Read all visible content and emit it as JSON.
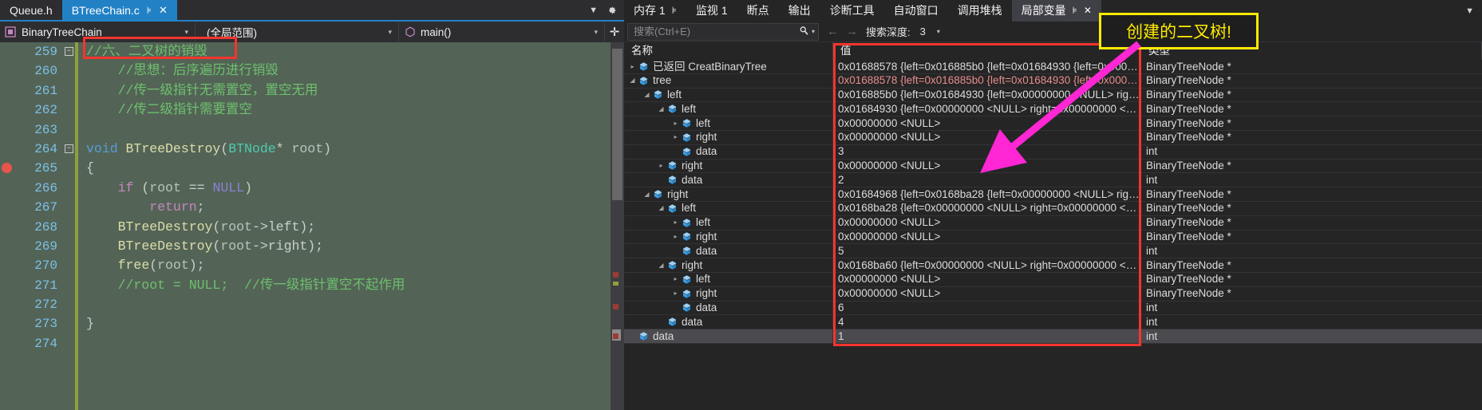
{
  "editor": {
    "tabs": [
      {
        "label": "Queue.h",
        "active": false
      },
      {
        "label": "BTreeChain.c",
        "active": true,
        "pin": "⊧",
        "close": "✕"
      }
    ],
    "nav": {
      "project": "BinaryTreeChain",
      "scope": "(全局范围)",
      "func": "main()",
      "arrow": "▾",
      "split_icon": "✛"
    },
    "lines": [
      {
        "num": "259",
        "fold": "−",
        "tokens": [
          {
            "t": "//六、二叉树的销毁",
            "c": "tok-comment"
          }
        ]
      },
      {
        "num": "260",
        "tokens": [
          {
            "t": "    //思想：后序遍历进行销毁",
            "c": "tok-comment"
          }
        ]
      },
      {
        "num": "261",
        "tokens": [
          {
            "t": "    //传一级指针无需置空，置空无用",
            "c": "tok-comment"
          }
        ]
      },
      {
        "num": "262",
        "tokens": [
          {
            "t": "    //传二级指针需要置空",
            "c": "tok-comment"
          }
        ]
      },
      {
        "num": "263",
        "tokens": []
      },
      {
        "num": "264",
        "fold": "−",
        "tokens": [
          {
            "t": "void",
            "c": "tok-kw"
          },
          {
            "t": " ",
            "c": "tok-plain"
          },
          {
            "t": "BTreeDestroy",
            "c": "tok-fn"
          },
          {
            "t": "(",
            "c": "tok-punct"
          },
          {
            "t": "BTNode",
            "c": "tok-type"
          },
          {
            "t": "* ",
            "c": "tok-punct"
          },
          {
            "t": "root",
            "c": "tok-plain"
          },
          {
            "t": ")",
            "c": "tok-punct"
          }
        ]
      },
      {
        "num": "265",
        "tokens": [
          {
            "t": "{",
            "c": "tok-punct"
          }
        ],
        "breakpoint": true
      },
      {
        "num": "266",
        "tokens": [
          {
            "t": "    ",
            "c": "tok-plain"
          },
          {
            "t": "if",
            "c": "tok-ctl"
          },
          {
            "t": " (",
            "c": "tok-punct"
          },
          {
            "t": "root",
            "c": "tok-plain"
          },
          {
            "t": " == ",
            "c": "tok-punct"
          },
          {
            "t": "NULL",
            "c": "tok-macro"
          },
          {
            "t": ")",
            "c": "tok-punct"
          }
        ]
      },
      {
        "num": "267",
        "tokens": [
          {
            "t": "        ",
            "c": "tok-plain"
          },
          {
            "t": "return",
            "c": "tok-ctl"
          },
          {
            "t": ";",
            "c": "tok-punct"
          }
        ]
      },
      {
        "num": "268",
        "tokens": [
          {
            "t": "    ",
            "c": "tok-plain"
          },
          {
            "t": "BTreeDestroy",
            "c": "tok-fn"
          },
          {
            "t": "(",
            "c": "tok-punct"
          },
          {
            "t": "root",
            "c": "tok-plain"
          },
          {
            "t": "->",
            "c": "tok-punct"
          },
          {
            "t": "left",
            "c": "tok-punct"
          },
          {
            "t": ");",
            "c": "tok-punct"
          }
        ]
      },
      {
        "num": "269",
        "tokens": [
          {
            "t": "    ",
            "c": "tok-plain"
          },
          {
            "t": "BTreeDestroy",
            "c": "tok-fn"
          },
          {
            "t": "(",
            "c": "tok-punct"
          },
          {
            "t": "root",
            "c": "tok-plain"
          },
          {
            "t": "->",
            "c": "tok-punct"
          },
          {
            "t": "right",
            "c": "tok-punct"
          },
          {
            "t": ");",
            "c": "tok-punct"
          }
        ]
      },
      {
        "num": "270",
        "tokens": [
          {
            "t": "    ",
            "c": "tok-plain"
          },
          {
            "t": "free",
            "c": "tok-fn"
          },
          {
            "t": "(",
            "c": "tok-punct"
          },
          {
            "t": "root",
            "c": "tok-plain"
          },
          {
            "t": ");",
            "c": "tok-punct"
          }
        ]
      },
      {
        "num": "271",
        "tokens": [
          {
            "t": "    //root = NULL;  //传一级指针置空不起作用",
            "c": "tok-comment"
          }
        ]
      },
      {
        "num": "272",
        "tokens": []
      },
      {
        "num": "273",
        "tokens": [
          {
            "t": "}",
            "c": "tok-punct"
          }
        ]
      },
      {
        "num": "274",
        "tokens": []
      }
    ]
  },
  "debug": {
    "tabs": [
      {
        "label": "内存 1",
        "pin": "⊧",
        "selected": false
      },
      {
        "label": "监视 1",
        "selected": false
      },
      {
        "label": "断点",
        "selected": false
      },
      {
        "label": "输出",
        "selected": false
      },
      {
        "label": "诊断工具",
        "selected": false
      },
      {
        "label": "自动窗口",
        "selected": false
      },
      {
        "label": "调用堆栈",
        "selected": false
      },
      {
        "label": "局部变量",
        "pin": "⊧",
        "close": "✕",
        "selected": true
      }
    ],
    "toolbar": {
      "search_placeholder": "搜索(Ctrl+E)",
      "search_value": "",
      "search_icon": "search-icon",
      "prev_icon": "←",
      "next_icon": "→",
      "depth_label": "搜索深度:",
      "depth_value": "3",
      "dropdown_arrow": "▾"
    },
    "columns": {
      "name": "名称",
      "value": "值",
      "type": "类型"
    },
    "rows": [
      {
        "depth": 0,
        "expander": "▸",
        "name": "已返回 CreatBinaryTree",
        "value": "0x01688578 {left=0x016885b0 {left=0x01684930 {left=0x0000000…",
        "type": "BinaryTreeNode *",
        "changed": false
      },
      {
        "depth": 0,
        "expander": "◢",
        "name": "tree",
        "value": "0x01688578 {left=0x016885b0 {left=0x01684930 {left=0x0000000…",
        "type": "BinaryTreeNode *",
        "changed": true
      },
      {
        "depth": 1,
        "expander": "◢",
        "name": "left",
        "value": "0x016885b0 {left=0x01684930 {left=0x00000000 <NULL> right=0…",
        "type": "BinaryTreeNode *",
        "changed": false
      },
      {
        "depth": 2,
        "expander": "◢",
        "name": "left",
        "value": "0x01684930 {left=0x00000000 <NULL> right=0x00000000 <NULL…",
        "type": "BinaryTreeNode *",
        "changed": false
      },
      {
        "depth": 3,
        "expander": "▸",
        "name": "left",
        "value": "0x00000000 <NULL>",
        "type": "BinaryTreeNode *",
        "changed": false
      },
      {
        "depth": 3,
        "expander": "▸",
        "name": "right",
        "value": "0x00000000 <NULL>",
        "type": "BinaryTreeNode *",
        "changed": false
      },
      {
        "depth": 3,
        "expander": "",
        "name": "data",
        "value": "3",
        "type": "int",
        "changed": false
      },
      {
        "depth": 2,
        "expander": "▸",
        "name": "right",
        "value": "0x00000000 <NULL>",
        "type": "BinaryTreeNode *",
        "changed": false
      },
      {
        "depth": 2,
        "expander": "",
        "name": "data",
        "value": "2",
        "type": "int",
        "changed": false
      },
      {
        "depth": 1,
        "expander": "◢",
        "name": "right",
        "value": "0x01684968 {left=0x0168ba28 {left=0x00000000 <NULL> right=0…",
        "type": "BinaryTreeNode *",
        "changed": false
      },
      {
        "depth": 2,
        "expander": "◢",
        "name": "left",
        "value": "0x0168ba28 {left=0x00000000 <NULL> right=0x00000000 <NULL…",
        "type": "BinaryTreeNode *",
        "changed": false
      },
      {
        "depth": 3,
        "expander": "▸",
        "name": "left",
        "value": "0x00000000 <NULL>",
        "type": "BinaryTreeNode *",
        "changed": false
      },
      {
        "depth": 3,
        "expander": "▸",
        "name": "right",
        "value": "0x00000000 <NULL>",
        "type": "BinaryTreeNode *",
        "changed": false
      },
      {
        "depth": 3,
        "expander": "",
        "name": "data",
        "value": "5",
        "type": "int",
        "changed": false
      },
      {
        "depth": 2,
        "expander": "◢",
        "name": "right",
        "value": "0x0168ba60 {left=0x00000000 <NULL> right=0x00000000 <NULL…",
        "type": "BinaryTreeNode *",
        "changed": false
      },
      {
        "depth": 3,
        "expander": "▸",
        "name": "left",
        "value": "0x00000000 <NULL>",
        "type": "BinaryTreeNode *",
        "changed": false
      },
      {
        "depth": 3,
        "expander": "▸",
        "name": "right",
        "value": "0x00000000 <NULL>",
        "type": "BinaryTreeNode *",
        "changed": false
      },
      {
        "depth": 3,
        "expander": "",
        "name": "data",
        "value": "6",
        "type": "int",
        "changed": false
      },
      {
        "depth": 2,
        "expander": "",
        "name": "data",
        "value": "4",
        "type": "int",
        "changed": false
      },
      {
        "depth": 0,
        "expander": "",
        "name": "data",
        "value": "1",
        "type": "int",
        "changed": false,
        "selected": true
      }
    ]
  },
  "annotations": {
    "callout_text": "创建的二叉树!",
    "callout_color": "#ffea00",
    "rect_color": "#f4352e",
    "arrow_color": "#ff26d4"
  }
}
